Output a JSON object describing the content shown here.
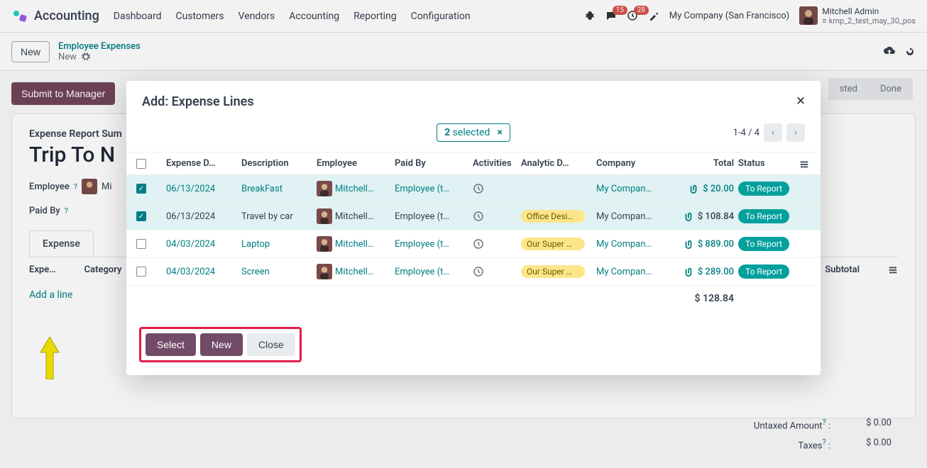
{
  "nav": {
    "app": "Accounting",
    "items": [
      "Dashboard",
      "Customers",
      "Vendors",
      "Accounting",
      "Reporting",
      "Configuration"
    ],
    "badge1": "15",
    "badge2": "28",
    "company": "My Company (San Francisco)",
    "user_name": "Mitchell Admin",
    "user_sub": "kmp_2_test_may_30_pos"
  },
  "sub": {
    "new_btn": "New",
    "breadcrumb_link": "Employee Expenses",
    "breadcrumb_sub": "New"
  },
  "page": {
    "submit_btn": "Submit to Manager",
    "status_posted": "sted",
    "status_done": "Done",
    "summary_label": "Expense Report Sum",
    "title": "Trip To N",
    "employee_label": "Employee",
    "employee_val": "Mi",
    "paidby_label": "Paid By",
    "tab_expense": "Expense",
    "col_expense": "Expe…",
    "col_category": "Category",
    "col_subtotal": "Subtotal",
    "add_line": "Add a line",
    "untaxed_label": "Untaxed Amount",
    "taxes_label": "Taxes",
    "zero": "$ 0.00"
  },
  "modal": {
    "title": "Add: Expense Lines",
    "selected_count": "2",
    "selected_label": " selected",
    "pager": "1-4 / 4",
    "headers": {
      "date": "Expense D…",
      "desc": "Description",
      "emp": "Employee",
      "paid": "Paid By",
      "act": "Activities",
      "ana": "Analytic D…",
      "comp": "Company",
      "total": "Total",
      "status": "Status"
    },
    "rows": [
      {
        "checked": true,
        "date": "06/13/2024",
        "desc": "BreakFast",
        "emp": "Mitchell…",
        "paid": "Employee (t…",
        "ana": "",
        "comp": "My Compan…",
        "total": "$ 20.00",
        "status": "To Report",
        "linkstyle": true
      },
      {
        "checked": true,
        "date": "06/13/2024",
        "desc": "Travel by car",
        "emp": "Mitchell…",
        "paid": "Employee (t…",
        "ana": "Office Desi…",
        "comp": "My Compan…",
        "total": "$ 108.84",
        "status": "To Report",
        "linkstyle": false
      },
      {
        "checked": false,
        "date": "04/03/2024",
        "desc": "Laptop",
        "emp": "Mitchell…",
        "paid": "Employee (t…",
        "ana": "Our Super …",
        "comp": "My Compan…",
        "total": "$ 889.00",
        "status": "To Report",
        "linkstyle": true
      },
      {
        "checked": false,
        "date": "04/03/2024",
        "desc": "Screen",
        "emp": "Mitchell…",
        "paid": "Employee (t…",
        "ana": "Our Super …",
        "comp": "My Compan…",
        "total": "$ 289.00",
        "status": "To Report",
        "linkstyle": true
      }
    ],
    "sum": "$ 128.84",
    "btn_select": "Select",
    "btn_new": "New",
    "btn_close": "Close"
  }
}
